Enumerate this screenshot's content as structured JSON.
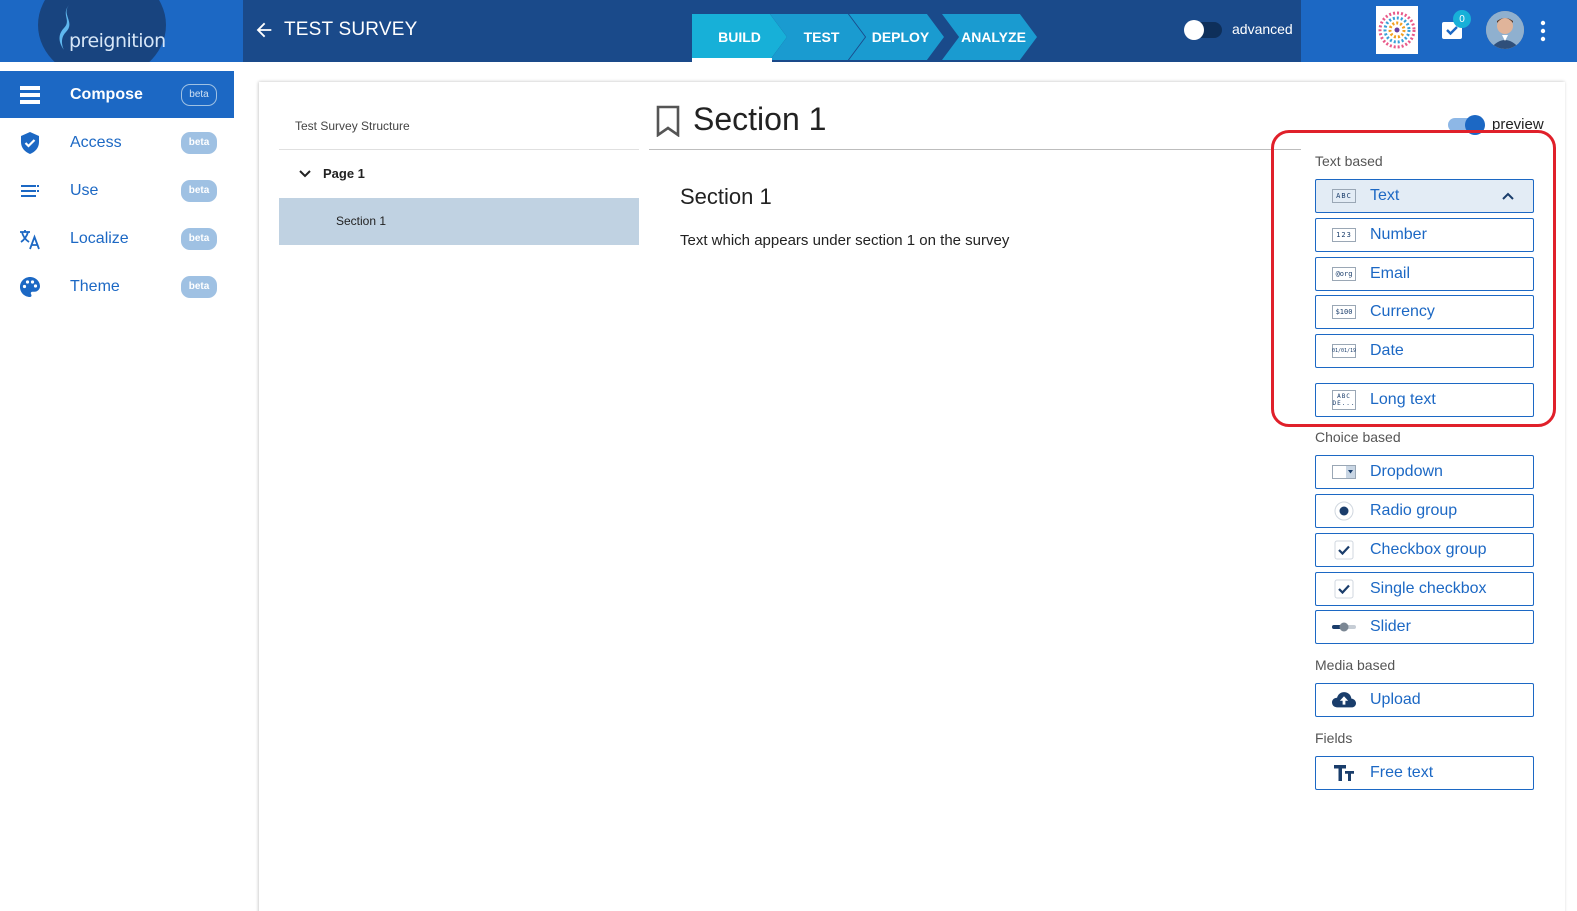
{
  "header": {
    "logo_text": "preignition",
    "survey_title": "TEST SURVEY",
    "steps": [
      "BUILD",
      "TEST",
      "DEPLOY",
      "ANALYZE"
    ],
    "active_step": "BUILD",
    "advanced_label": "advanced",
    "notification_count": "0",
    "brand_color": "#1a4a8a",
    "accent_color": "#1c68c4"
  },
  "sidebar": {
    "items": [
      {
        "label": "Compose",
        "badge": "beta",
        "icon": "compose-icon",
        "active": true
      },
      {
        "label": "Access",
        "badge": "beta",
        "icon": "shield-check-icon",
        "active": false
      },
      {
        "label": "Use",
        "badge": "beta",
        "icon": "list-icon",
        "active": false
      },
      {
        "label": "Localize",
        "badge": "beta",
        "icon": "translate-icon",
        "active": false
      },
      {
        "label": "Theme",
        "badge": "beta",
        "icon": "palette-icon",
        "active": false
      }
    ]
  },
  "structure": {
    "title": "Test Survey Structure",
    "page_label": "Page 1",
    "section_label": "Section 1"
  },
  "editor": {
    "heading": "Section 1",
    "sub_heading": "Section 1",
    "description": "Text which appears under section 1 on the survey",
    "preview_label": "preview"
  },
  "palette": {
    "text_based": {
      "title": "Text based",
      "items": [
        {
          "label": "Text",
          "icon_text": "ABC"
        },
        {
          "label": "Number",
          "icon_text": "123"
        },
        {
          "label": "Email",
          "icon_text": "@org"
        },
        {
          "label": "Currency",
          "icon_text": "$100"
        },
        {
          "label": "Date",
          "icon_text": "01/01/19"
        },
        {
          "label": "Long text",
          "icon_text": "ABC DE..."
        }
      ]
    },
    "choice_based": {
      "title": "Choice based",
      "items": [
        {
          "label": "Dropdown"
        },
        {
          "label": "Radio group"
        },
        {
          "label": "Checkbox group"
        },
        {
          "label": "Single checkbox"
        },
        {
          "label": "Slider"
        }
      ]
    },
    "media_based": {
      "title": "Media based",
      "items": [
        {
          "label": "Upload"
        }
      ]
    },
    "fields": {
      "title": "Fields",
      "items": [
        {
          "label": "Free text"
        }
      ]
    }
  }
}
